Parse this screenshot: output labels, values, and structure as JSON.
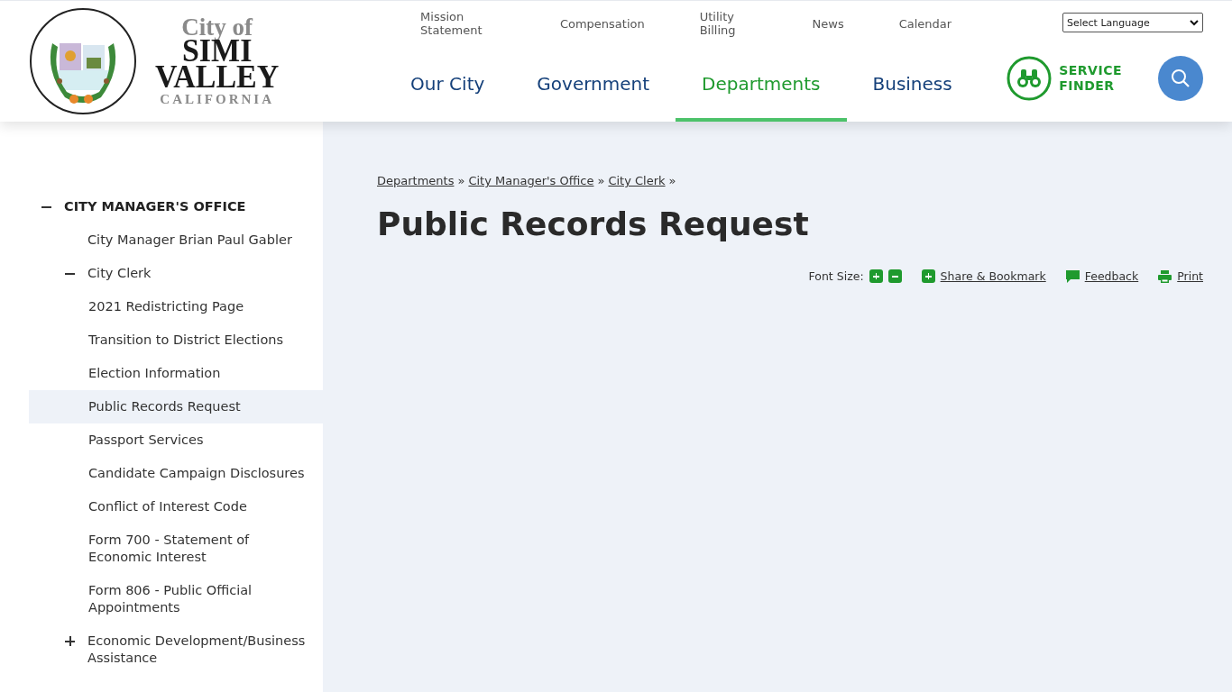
{
  "header": {
    "logo": {
      "line1": "City of",
      "line2": "SIMI",
      "line3": "VALLEY",
      "line4": "CALIFORNIA"
    },
    "utility_nav": [
      "Mission Statement",
      "Compensation",
      "Utility Billing",
      "News",
      "Calendar"
    ],
    "language_select": {
      "value": "Select Language"
    },
    "main_nav": [
      {
        "label": "Our City",
        "selected": false
      },
      {
        "label": "Government",
        "selected": false
      },
      {
        "label": "Departments",
        "selected": true
      },
      {
        "label": "Business",
        "selected": false
      }
    ],
    "service_finder": {
      "line1": "SERVICE",
      "line2": "FINDER"
    }
  },
  "sidebar": {
    "items": [
      {
        "label": "CITY MANAGER'S OFFICE",
        "selected": false,
        "expanded": true,
        "children": [
          {
            "label": "City Manager Brian Paul Gabler",
            "selected": false
          },
          {
            "label": "City Clerk",
            "selected": false,
            "expanded": true,
            "children": [
              {
                "label": "2021 Redistricting Page",
                "selected": false
              },
              {
                "label": "Transition to District Elections",
                "selected": false
              },
              {
                "label": "Election Information",
                "selected": false
              },
              {
                "label": "Public Records Request",
                "selected": true
              },
              {
                "label": "Passport Services",
                "selected": false
              },
              {
                "label": "Candidate Campaign Disclosures",
                "selected": false
              },
              {
                "label": "Conflict of Interest Code",
                "selected": false
              },
              {
                "label": "Form 700 - Statement of Economic Interest",
                "selected": false
              },
              {
                "label": "Form 806 - Public Official Appointments",
                "selected": false
              }
            ]
          },
          {
            "label": "Economic Development/Business Assistance",
            "selected": false,
            "expanded": false
          }
        ]
      }
    ]
  },
  "breadcrumbs": {
    "items": [
      "Departments",
      "City Manager's Office",
      "City Clerk"
    ],
    "separator": "»"
  },
  "title": "Public Records Request",
  "tools": {
    "font_size_label": "Font Size:",
    "share": "Share & Bookmark",
    "feedback": "Feedback",
    "print": "Print"
  }
}
